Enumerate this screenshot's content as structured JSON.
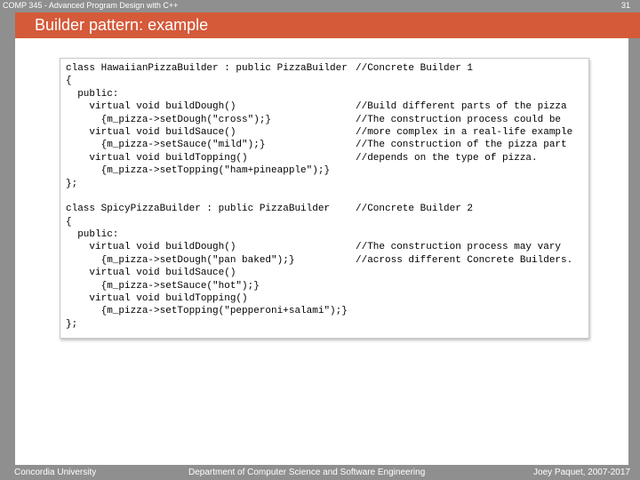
{
  "header": {
    "course": "COMP 345 - Advanced Program Design with C++",
    "page_number": "31"
  },
  "title": "Builder pattern: example",
  "code_lines": [
    {
      "code": "class HawaiianPizzaBuilder : public PizzaBuilder",
      "comment": "//Concrete Builder 1"
    },
    {
      "code": "{",
      "comment": ""
    },
    {
      "code": "  public:",
      "comment": ""
    },
    {
      "code": "    virtual void buildDough()",
      "comment": "//Build different parts of the pizza"
    },
    {
      "code": "      {m_pizza->setDough(\"cross\");}",
      "comment": "//The construction process could be"
    },
    {
      "code": "    virtual void buildSauce()",
      "comment": "//more complex in a real-life example"
    },
    {
      "code": "      {m_pizza->setSauce(\"mild\");}",
      "comment": "//The construction of the pizza part"
    },
    {
      "code": "    virtual void buildTopping()",
      "comment": "//depends on the type of pizza."
    },
    {
      "code": "      {m_pizza->setTopping(\"ham+pineapple\");}",
      "comment": ""
    },
    {
      "code": "};",
      "comment": ""
    },
    {
      "code": "",
      "comment": ""
    },
    {
      "code": "class SpicyPizzaBuilder : public PizzaBuilder",
      "comment": "//Concrete Builder 2"
    },
    {
      "code": "{",
      "comment": ""
    },
    {
      "code": "  public:",
      "comment": ""
    },
    {
      "code": "    virtual void buildDough()",
      "comment": "//The construction process may vary"
    },
    {
      "code": "      {m_pizza->setDough(\"pan baked\");}",
      "comment": "//across different Concrete Builders."
    },
    {
      "code": "    virtual void buildSauce()",
      "comment": ""
    },
    {
      "code": "      {m_pizza->setSauce(\"hot\");}",
      "comment": ""
    },
    {
      "code": "    virtual void buildTopping()",
      "comment": ""
    },
    {
      "code": "      {m_pizza->setTopping(\"pepperoni+salami\");}",
      "comment": ""
    },
    {
      "code": "};",
      "comment": ""
    }
  ],
  "footer": {
    "left": "Concordia University",
    "center": "Department of Computer Science and Software Engineering",
    "right": "Joey Paquet, 2007-2017"
  },
  "colors": {
    "background": "#8f8f8f",
    "title_bar": "#d45a3a",
    "text_light": "#ffffff"
  }
}
